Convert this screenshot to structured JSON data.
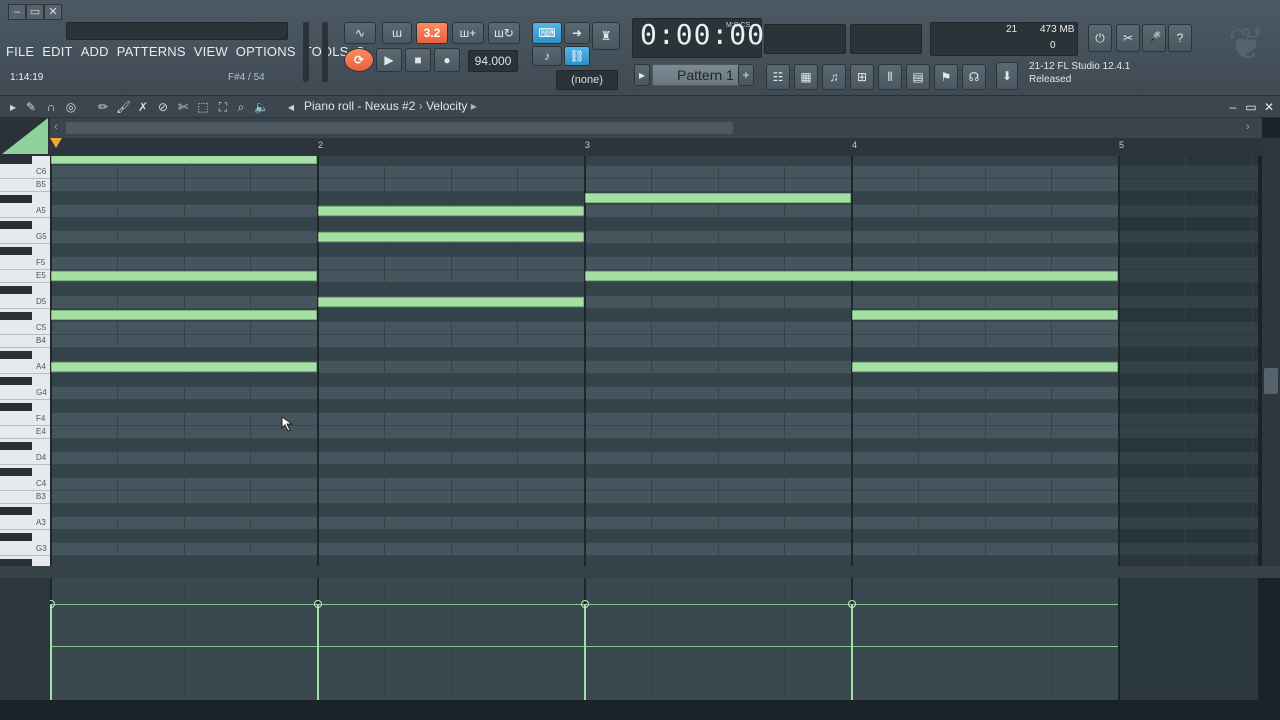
{
  "app": {
    "menu": [
      "FILE",
      "EDIT",
      "ADD",
      "PATTERNS",
      "VIEW",
      "OPTIONS",
      "TOOLS",
      "?"
    ],
    "hint_time": "1:14:19",
    "hint_note": "F#4 / 54",
    "win_buttons": [
      "–",
      "▭",
      "✕"
    ]
  },
  "transport": {
    "pattern_song_label": "3.2",
    "tempo": "94.000",
    "time": "0:00:00",
    "time_unit": "M:S:CS",
    "pattern": "Pattern 1",
    "none_label": "(none)",
    "cpu": "21",
    "mem": "473 MB",
    "poly": "0"
  },
  "news": {
    "line1": "21-12  FL Studio 12.4.1",
    "line2": "Released"
  },
  "pianoroll": {
    "title": "Piano roll - Nexus #2",
    "target": "Velocity",
    "window_buttons": [
      "–",
      "▭",
      "✕"
    ],
    "bars": [
      "2",
      "3",
      "4",
      "5"
    ],
    "key_labels": [
      "C6",
      "B5",
      "A5",
      "G5",
      "F5",
      "E5",
      "D5",
      "C5",
      "B4",
      "A4",
      "G4",
      "F4",
      "E4",
      "D4",
      "C4",
      "B3",
      "A3",
      "G3"
    ]
  },
  "notes": [
    {
      "pitch": "C#6",
      "bar": 1,
      "len": 1
    },
    {
      "pitch": "A5",
      "bar": 2,
      "len": 1
    },
    {
      "pitch": "A#5",
      "bar": 3,
      "len": 1
    },
    {
      "pitch": "G5",
      "bar": 2,
      "len": 1
    },
    {
      "pitch": "E5",
      "bar": 1,
      "len": 1
    },
    {
      "pitch": "E5",
      "bar": 3,
      "len": 2
    },
    {
      "pitch": "D5",
      "bar": 2,
      "len": 1
    },
    {
      "pitch": "C#5",
      "bar": 1,
      "len": 1
    },
    {
      "pitch": "C#5",
      "bar": 4,
      "len": 1
    },
    {
      "pitch": "A4",
      "bar": 1,
      "len": 1
    },
    {
      "pitch": "A4",
      "bar": 4,
      "len": 1
    }
  ],
  "colors": {
    "note": "#a6dfa3",
    "accent_orange": "#f26b45",
    "accent_blue": "#3fa6dc"
  }
}
